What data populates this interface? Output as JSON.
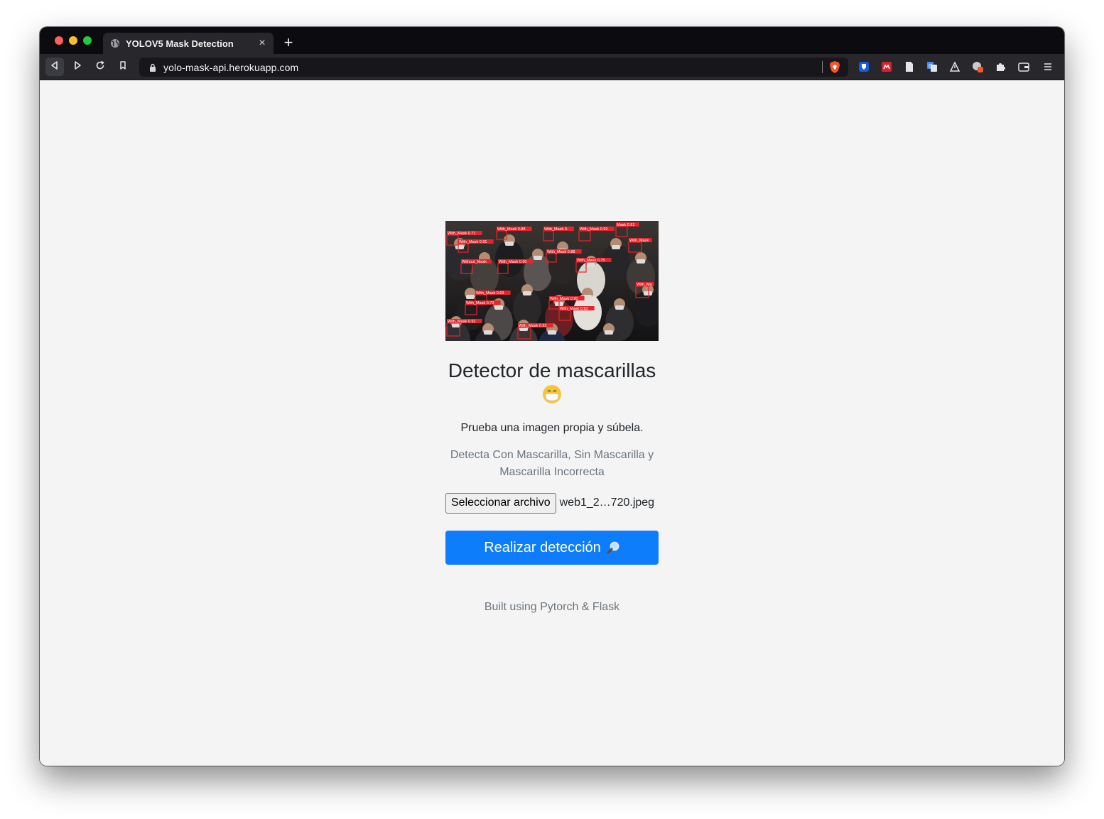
{
  "browser": {
    "tab": {
      "title": "YOLOV5 Mask Detection",
      "close_label": "×",
      "favicon": "globe-icon"
    },
    "new_tab_label": "+",
    "url": "yolo-mask-api.herokuapp.com",
    "toolbar_icons": [
      "back-icon",
      "forward-icon",
      "reload-icon",
      "bookmark-icon",
      "lock-icon",
      "brave-shield-icon"
    ],
    "extensions": [
      "bitwarden-icon",
      "mendeley-icon",
      "page-icon",
      "translate-icon",
      "alert-icon",
      "profile-icon",
      "puzzle-icon",
      "wallet-icon",
      "menu-icon"
    ],
    "colors": {
      "tabstrip": "#0c0c10",
      "toolbar": "#27272c",
      "urlbar": "#17171b"
    }
  },
  "page": {
    "hero_image": {
      "description_labels": [
        "With_Mask 0.71",
        "With_Mask 0.91",
        "With_Mask 0.88",
        "With_Mask 0.",
        "With_Mask 0.92",
        "Mask 0.91",
        "With_Mask",
        "With_Mask 0.88",
        "Without_Mask",
        "With_Mask 0.90",
        "With_Mask 0.75",
        "With_Ma",
        "With_Mask 0.63",
        "With_Mask 0.73",
        "With_Mask 0.90",
        "With_Mask 0.93",
        "With_Mask 0.92",
        "With_Mask 0.92"
      ]
    },
    "heading": "Detector de mascarillas",
    "heading_emoji": "😷",
    "lead": "Prueba una imagen propia y súbela.",
    "description": "Detecta Con Mascarilla, Sin Mascarilla y Mascarilla Incorrecta",
    "file_input": {
      "button_label": "Seleccionar archivo",
      "file_name": "web1_2…720.jpeg"
    },
    "submit_label": "Realizar detección",
    "submit_icon": "magnifier-icon",
    "footer": "Built using Pytorch & Flask",
    "colors": {
      "primary": "#0d7dfc",
      "muted": "#6c757d",
      "background": "#f4f4f4",
      "detection_box": "#e8232b"
    }
  }
}
